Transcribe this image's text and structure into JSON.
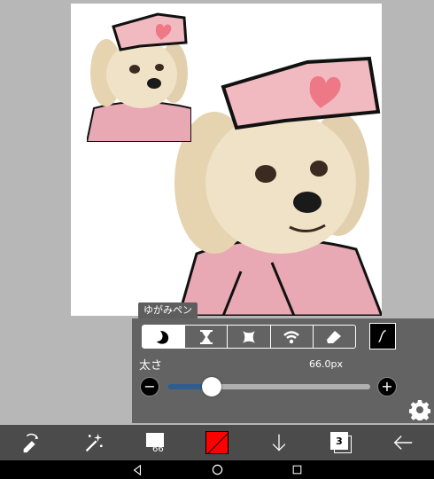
{
  "tool_label": "ゆがみペン",
  "pen_types": [
    {
      "icon": "crescent-pen-icon",
      "selected": true
    },
    {
      "icon": "hourglass-pen-icon",
      "selected": false
    },
    {
      "icon": "blob-pen-icon",
      "selected": false
    },
    {
      "icon": "spray-pen-icon",
      "selected": false
    },
    {
      "icon": "eraser-pen-icon",
      "selected": false
    }
  ],
  "size": {
    "label": "太さ",
    "value_text": "66.0px",
    "slider_fraction": 0.22
  },
  "toolbar": {
    "brush_size": "66",
    "color": "#ff0000",
    "layer_count": "3"
  },
  "colors": {
    "panel": "#636363",
    "toolbar": "#4b4b4b",
    "slider_fill": "#2f5d8e"
  }
}
